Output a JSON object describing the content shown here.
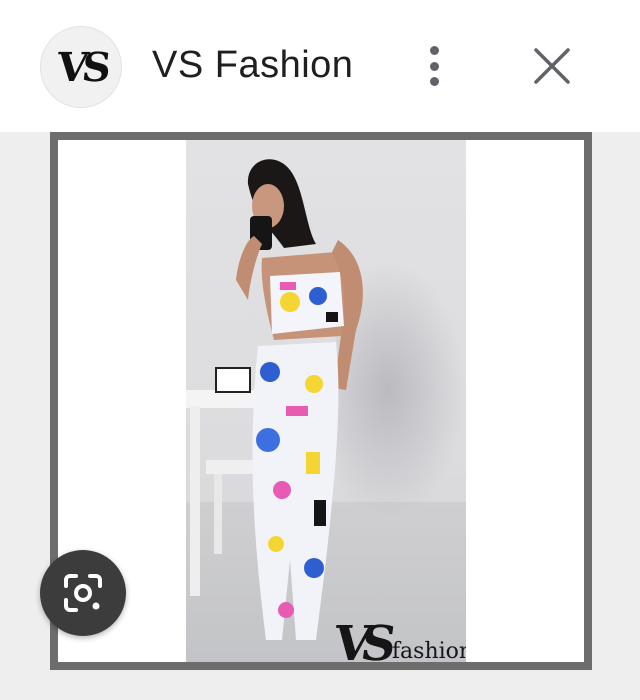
{
  "header": {
    "title": "VS Fashion",
    "avatar_logo": "VS",
    "icons": {
      "menu": "more-vert-icon",
      "close": "close-icon"
    }
  },
  "image": {
    "watermark_logo": "VS",
    "watermark_text": "fashion",
    "lens_icon": "google-lens-icon"
  },
  "colors": {
    "header_bg": "#ffffff",
    "viewer_bg": "#eeeeef",
    "frame_border": "#6d6d6d",
    "lens_button_bg": "#3c3c3c"
  }
}
